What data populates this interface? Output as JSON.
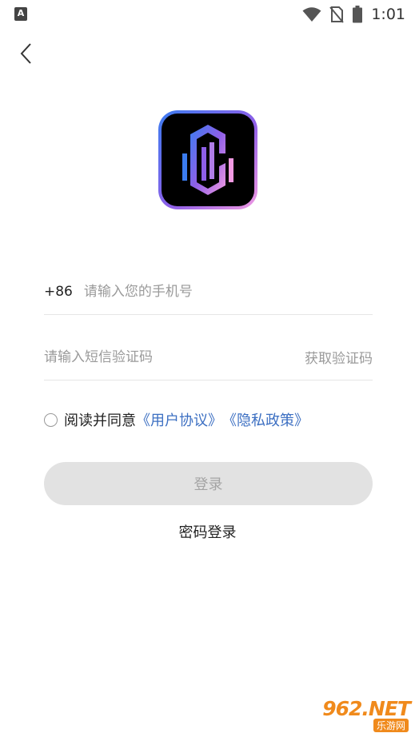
{
  "status_bar": {
    "app_badge": "A",
    "time": "1:01",
    "icons": [
      "notification-app-icon",
      "wifi-icon",
      "no-sim-icon",
      "battery-icon"
    ]
  },
  "nav": {
    "back_icon": "chevron-left-icon"
  },
  "logo": {
    "icon": "app-logo",
    "colors": {
      "gradient_start": "#3b7cf0",
      "gradient_mid": "#8e5fe8",
      "gradient_end": "#f29ae2",
      "background": "#000000"
    }
  },
  "form": {
    "country_code": "+86",
    "phone_placeholder": "请输入您的手机号",
    "phone_value": "",
    "code_placeholder": "请输入短信验证码",
    "code_value": "",
    "get_code_label": "获取验证码"
  },
  "agreement": {
    "checked": false,
    "text": "阅读并同意",
    "user_agreement": "《用户协议》",
    "privacy_policy": "《隐私政策》",
    "link_color": "#3c6fc2"
  },
  "actions": {
    "login_label": "登录",
    "password_login_label": "密码登录"
  },
  "watermark": {
    "main": "962.NET",
    "sub": "乐游网"
  }
}
